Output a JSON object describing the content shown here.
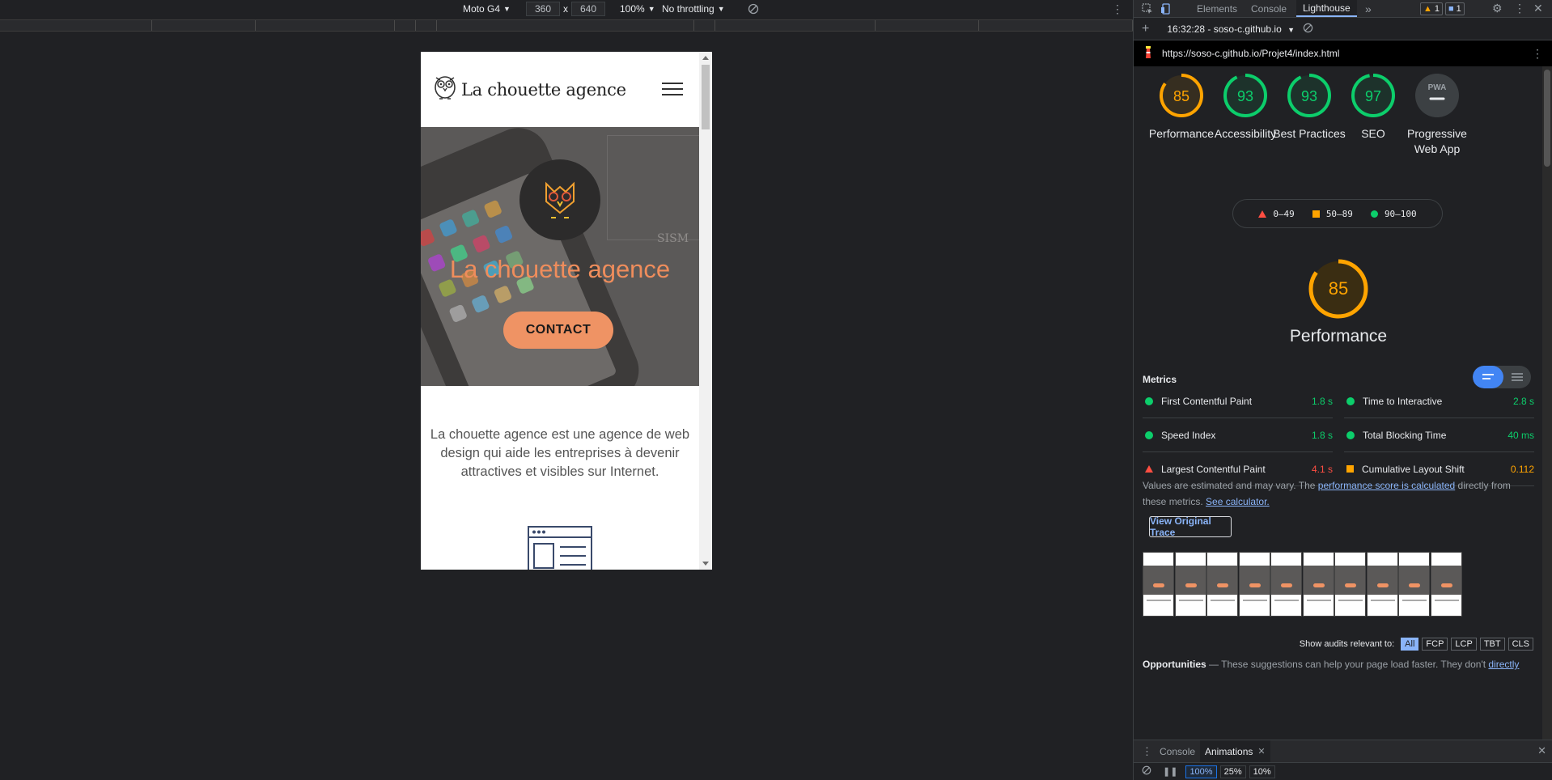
{
  "device_toolbar": {
    "device": "Moto G4",
    "width": "360",
    "times": "x",
    "height": "640",
    "zoom": "100%",
    "throttling": "No throttling"
  },
  "site": {
    "logo_text": "La chouette agence",
    "hero_title": "La chouette agence",
    "contact_label": "CONTACT",
    "intro": "La chouette agence est une agence de web design qui aide les entreprises à devenir attractives et visibles sur Internet.",
    "sketch_text": "SISM",
    "accent": "#ef9364"
  },
  "devtools": {
    "tabs": [
      "Elements",
      "Console",
      "Lighthouse"
    ],
    "more": "»",
    "warnings": "1",
    "messages": "1",
    "report_label": "16:32:28 - soso-c.github.io",
    "url": "https://soso-c.github.io/Projet4/index.html"
  },
  "scores": [
    {
      "label": "Performance",
      "value": 85,
      "text": "85",
      "color": "#ffa400"
    },
    {
      "label": "Accessibility",
      "value": 93,
      "text": "93",
      "color": "#0cce6b"
    },
    {
      "label": "Best Practices",
      "value": 93,
      "text": "93",
      "color": "#0cce6b"
    },
    {
      "label": "SEO",
      "value": 97,
      "text": "97",
      "color": "#0cce6b"
    },
    {
      "label": "Progressive Web App",
      "value": 0,
      "text": "PWA",
      "color": "#9aa0a6"
    }
  ],
  "legend": {
    "fail": "0–49",
    "average": "50–89",
    "pass": "90–100",
    "fail_color": "#ff4e42",
    "average_color": "#ffa400",
    "pass_color": "#0cce6b"
  },
  "performance": {
    "score": "85",
    "label": "Performance",
    "metrics_title": "Metrics",
    "metrics": [
      {
        "name": "First Contentful Paint",
        "value": "1.8 s",
        "status": "pass"
      },
      {
        "name": "Time to Interactive",
        "value": "2.8 s",
        "status": "pass"
      },
      {
        "name": "Speed Index",
        "value": "1.8 s",
        "status": "pass"
      },
      {
        "name": "Total Blocking Time",
        "value": "40 ms",
        "status": "pass"
      },
      {
        "name": "Largest Contentful Paint",
        "value": "4.1 s",
        "status": "fail"
      },
      {
        "name": "Cumulative Layout Shift",
        "value": "0.112",
        "status": "average"
      }
    ],
    "note_prefix": "Values are estimated and may vary. The ",
    "note_link": "performance score is calculated",
    "note_mid": " directly from these metrics. ",
    "note_link2": "See calculator.",
    "view_trace": "View Original Trace",
    "filmstrip_frames": 10
  },
  "audits_filter": {
    "label": "Show audits relevant to:",
    "chips": [
      "All",
      "FCP",
      "LCP",
      "TBT",
      "CLS"
    ],
    "active": "All"
  },
  "opportunities": {
    "title": "Opportunities",
    "text": " — These suggestions can help your page load faster. They don't ",
    "link": "directly"
  },
  "drawer": {
    "tabs": [
      "Console",
      "Animations"
    ],
    "speeds": [
      "100%",
      "25%",
      "10%"
    ]
  }
}
